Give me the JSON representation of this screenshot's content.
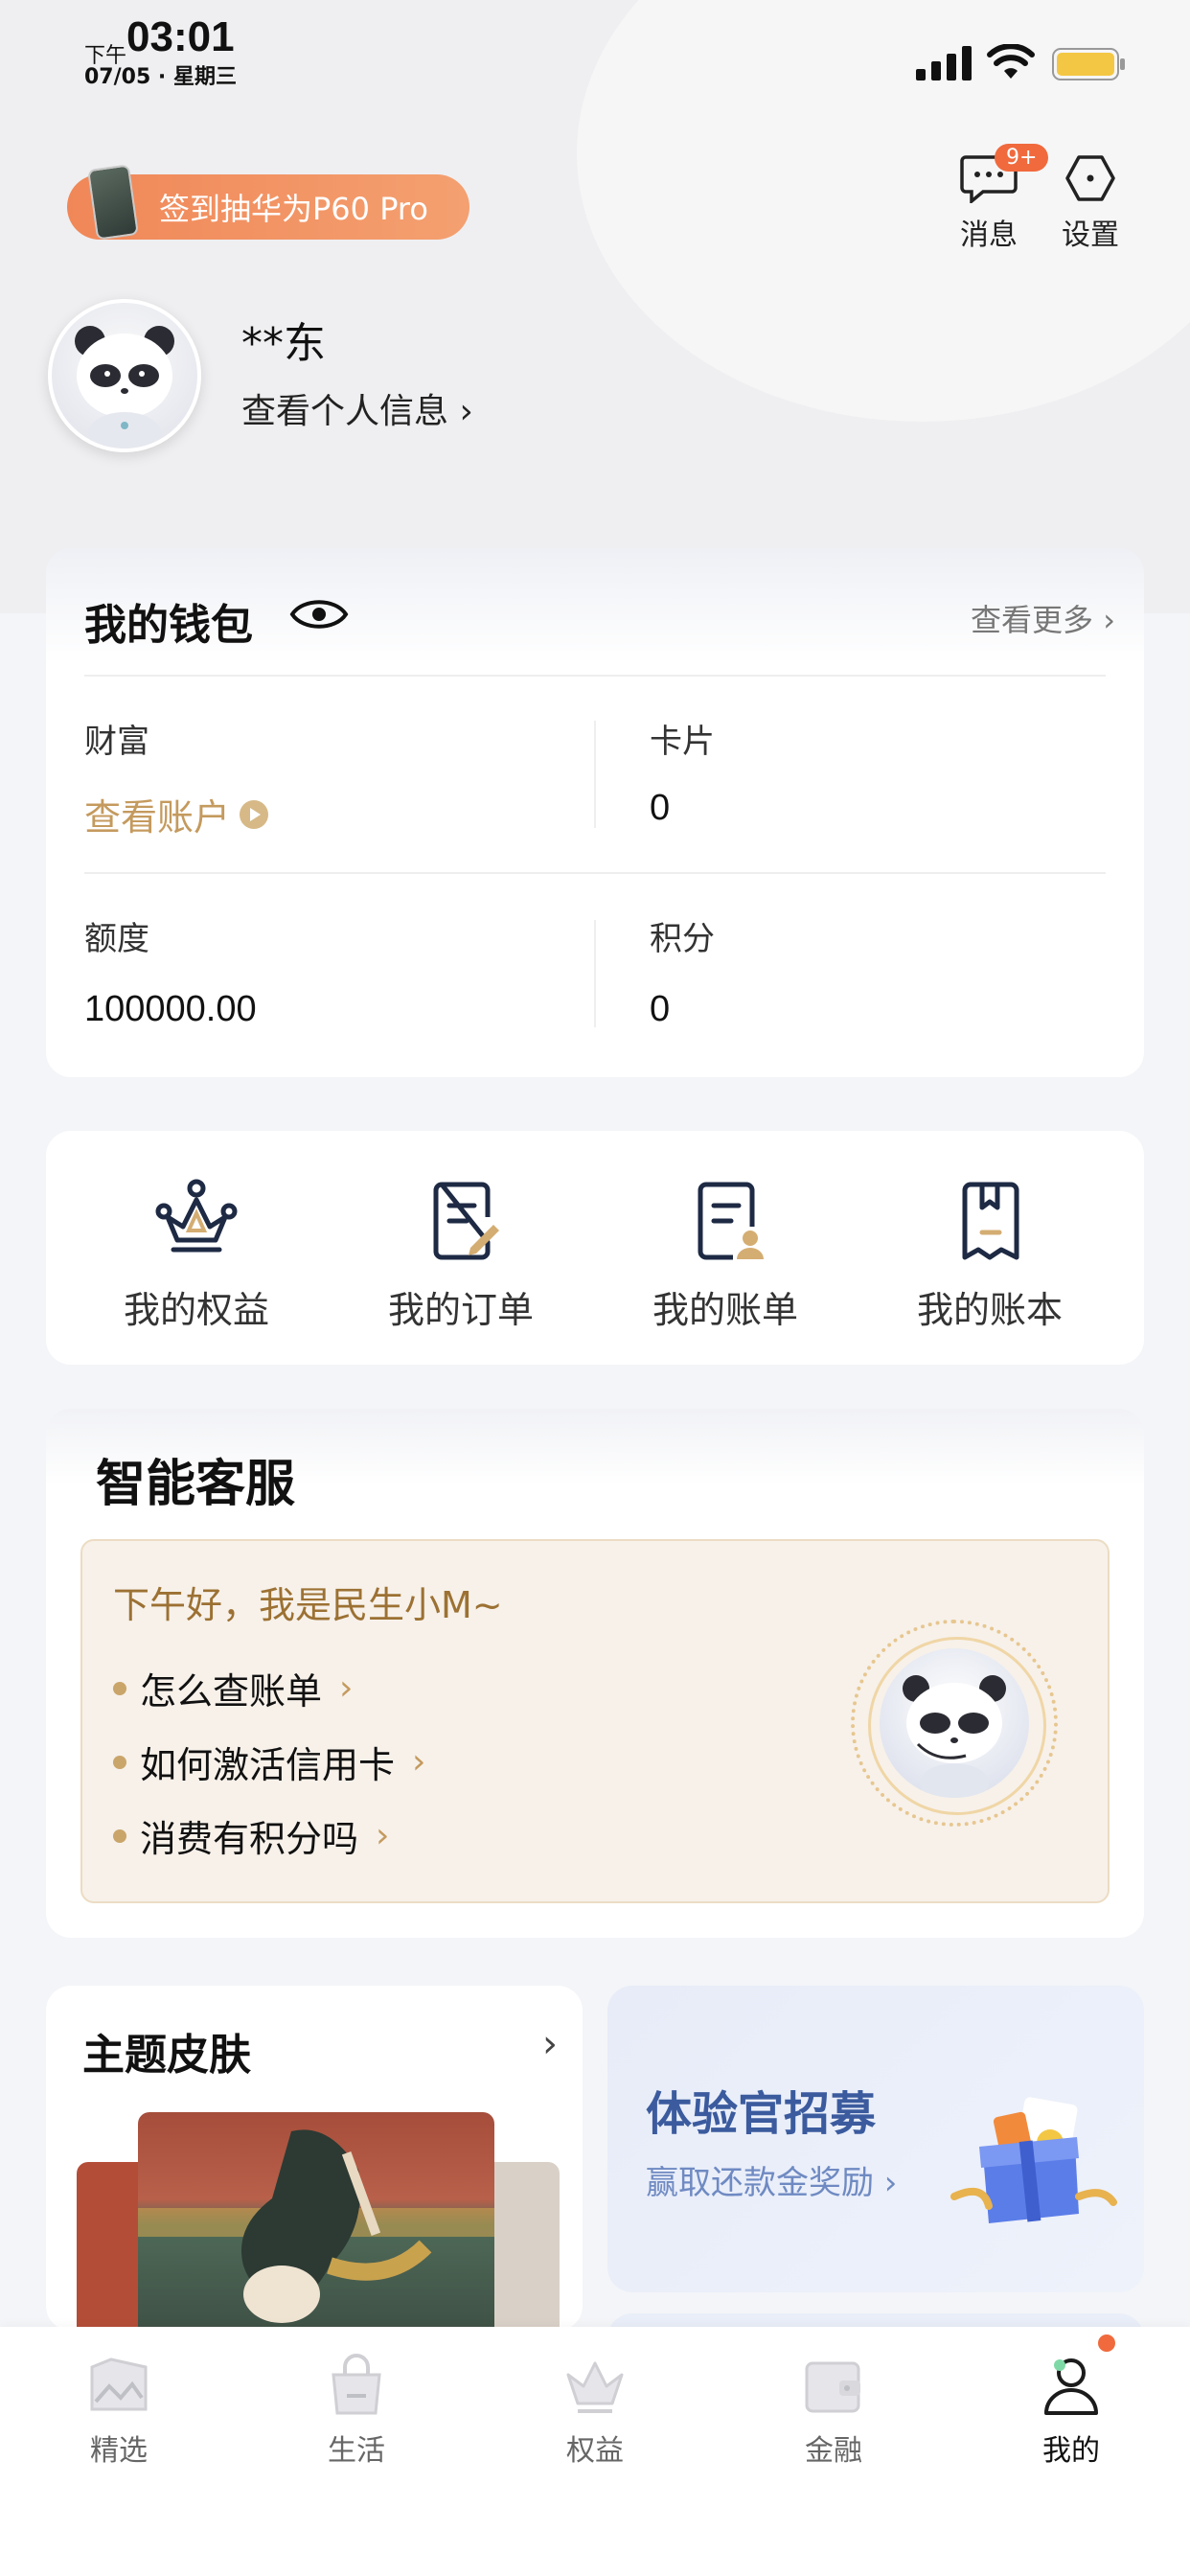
{
  "status_bar": {
    "period": "下午",
    "time": "03:01",
    "date": "07/05 · 星期三"
  },
  "header": {
    "promo_text": "签到抽华为P60 Pro",
    "messages_label": "消息",
    "messages_badge": "9+",
    "settings_label": "设置",
    "username": "**东",
    "profile_link": "查看个人信息 ›"
  },
  "wallet": {
    "title": "我的钱包",
    "more": "查看更多 ›",
    "wealth_label": "财富",
    "wealth_link": "查看账户",
    "cards_label": "卡片",
    "cards_value": "0",
    "credit_label": "额度",
    "credit_value": "100000.00",
    "points_label": "积分",
    "points_value": "0"
  },
  "shortcuts": [
    {
      "label": "我的权益",
      "icon": "crown-icon"
    },
    {
      "label": "我的订单",
      "icon": "order-edit-icon"
    },
    {
      "label": "我的账单",
      "icon": "bill-user-icon"
    },
    {
      "label": "我的账本",
      "icon": "bookmark-book-icon"
    }
  ],
  "customer_service": {
    "title": "智能客服",
    "greeting": "下午好，我是民生小M~",
    "faqs": [
      "怎么查账单",
      "如何激活信用卡",
      "消费有积分吗"
    ]
  },
  "theme": {
    "title": "主题皮肤"
  },
  "recruit": {
    "title": "体验官招募",
    "subtitle": "赢取还款金奖励 ›"
  },
  "tabbar": [
    {
      "label": "精选",
      "icon": "picture-icon"
    },
    {
      "label": "生活",
      "icon": "shopping-bag-icon"
    },
    {
      "label": "权益",
      "icon": "crown-icon"
    },
    {
      "label": "金融",
      "icon": "wallet-icon"
    },
    {
      "label": "我的",
      "icon": "person-icon",
      "active": true
    }
  ],
  "colors": {
    "accent_gold": "#c49a5e",
    "promo_orange": "#f08758",
    "badge_red": "#f06a3d",
    "recruit_blue": "#3b5b9e"
  }
}
